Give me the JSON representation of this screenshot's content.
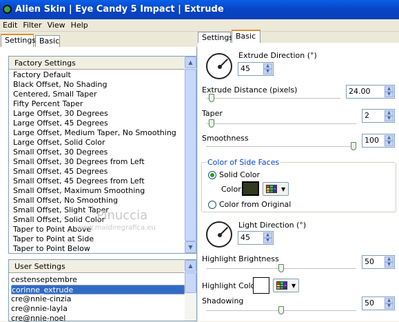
{
  "title": "Alien Skin | Eye Candy 5 Impact | Extrude",
  "menu": [
    "Edit",
    "Filter",
    "View",
    "Help"
  ],
  "left_tabs": [
    "Settings",
    "Basic"
  ],
  "right_tabs": [
    "Settings",
    "Basic"
  ],
  "factory": {
    "header": "Factory Settings",
    "items": [
      "Factory Default",
      "Black Offset, No Shading",
      "Centered, Small Taper",
      "Fifty Percent Taper",
      "Large Offset, 30 Degrees",
      "Large Offset, 45 Degrees",
      "Large Offset, Medium Taper, No Smoothing",
      "Large Offset, Solid Color",
      "Small Offset, 30 Degrees",
      "Small Offset, 30 Degrees from Left",
      "Small Offset, 45 Degrees",
      "Small Offset, 45 Degrees from Left",
      "Small Offset, Maximum Smoothing",
      "Small Offset, No Smoothing",
      "Small Offset, Slight Taper",
      "Small Offset, Solid Color",
      "Taper to Point Above",
      "Taper to Point at Side",
      "Taper to Point Below"
    ]
  },
  "user": {
    "header": "User Settings",
    "items": [
      "cestenseptembre",
      "corinne_extrude",
      "cre@nnie-cinzia",
      "cre@nnie-layla",
      "cre@nnie-noel"
    ],
    "selected": 1
  },
  "watermark": {
    "name": "Pinuccia",
    "site": "www.maidiregrafica.eu"
  },
  "params": {
    "extrude_direction": {
      "label": "Extrude Direction (°)",
      "value": "45",
      "angle": 45
    },
    "extrude_distance": {
      "label": "Extrude Distance (pixels)",
      "value": "24.00",
      "level": 0.02
    },
    "taper": {
      "label": "Taper",
      "value": "2",
      "level": 0.02
    },
    "smoothness": {
      "label": "Smoothness",
      "value": "100",
      "level": 1.0
    },
    "side_faces": {
      "legend": "Color of Side Faces",
      "solid": "Solid Color",
      "color_label": "Color",
      "from_original": "Color from Original",
      "color": "#333a22"
    },
    "light_direction": {
      "label": "Light Direction (°)",
      "value": "45",
      "angle": 45
    },
    "highlight_brightness": {
      "label": "Highlight Brightness",
      "value": "50",
      "level": 0.5
    },
    "highlight_color": {
      "label": "Highlight Color",
      "color": "#ffffff"
    },
    "shadowing": {
      "label": "Shadowing",
      "value": "50",
      "level": 0.5
    }
  }
}
